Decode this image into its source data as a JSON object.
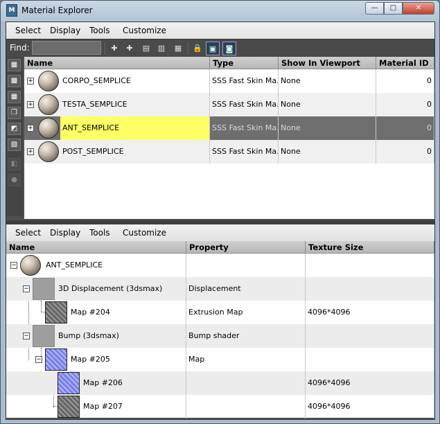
{
  "window": {
    "title": "Material Explorer",
    "app_icon_text": "M\n3DS"
  },
  "window_buttons": {
    "minimize": "—",
    "maximize": "□",
    "close": "✕"
  },
  "top_menu": [
    "Select",
    "Display",
    "Tools",
    "Customize"
  ],
  "find": {
    "label": "Find:",
    "value": ""
  },
  "toolbar_icons": [
    "select-all-icon",
    "select-none-icon",
    "invert-icon",
    "doc-icon",
    "doc-export-icon",
    "doc-import-icon",
    "lock-icon",
    "filter-scene-icon",
    "filter-map-icon"
  ],
  "left_tool_icons": [
    "display-list-icon",
    "checker-icon",
    "checker-icon",
    "layers-icon",
    "select-material-icon",
    "delete-material-icon",
    "cube-icon",
    "sphere-icon"
  ],
  "top_columns": [
    "Name",
    "Type",
    "Show In Viewport",
    "Material ID"
  ],
  "top_rows": [
    {
      "name": "CORPO_SEMPLICE",
      "type": "SSS Fast Skin Ma...",
      "viewport": "None",
      "id": "0",
      "selected": false
    },
    {
      "name": "TESTA_SEMPLICE",
      "type": "SSS Fast Skin Ma...",
      "viewport": "None",
      "id": "0",
      "selected": false
    },
    {
      "name": "ANT_SEMPLICE",
      "type": "SSS Fast Skin Ma...",
      "viewport": "None",
      "id": "0",
      "selected": true
    },
    {
      "name": "POST_SEMPLICE",
      "type": "SSS Fast Skin Ma...",
      "viewport": "None",
      "id": "0",
      "selected": false
    }
  ],
  "bottom_menu": [
    "Select",
    "Display",
    "Tools",
    "Customize"
  ],
  "bottom_columns": [
    "Name",
    "Property",
    "Texture Size"
  ],
  "bottom_rows": [
    {
      "name": "ANT_SEMPLICE",
      "property": "",
      "texture": ""
    },
    {
      "name": "3D Displacement (3dsmax)",
      "property": "Displacement",
      "texture": ""
    },
    {
      "name": "Map #204",
      "property": "Extrusion Map",
      "texture": "4096*4096"
    },
    {
      "name": "Bump (3dsmax)",
      "property": "Bump shader",
      "texture": ""
    },
    {
      "name": "Map #205",
      "property": "Map",
      "texture": ""
    },
    {
      "name": "Map #206",
      "property": "",
      "texture": "4096*4096"
    },
    {
      "name": "Map #207",
      "property": "",
      "texture": "4096*4096"
    }
  ],
  "colors": {
    "selected_row": "#6e6e6e",
    "selected_name_cell": "#ffff66",
    "selected_text": "#d9d9d9"
  }
}
